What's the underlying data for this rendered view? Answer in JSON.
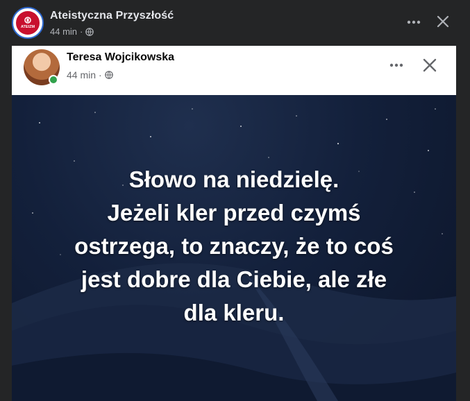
{
  "outer_post": {
    "page_name": "Ateistyczna Przyszłość",
    "avatar_text": "ATEIZM",
    "time": "44 min",
    "separator": "·",
    "more_icon": "more-horizontal-icon",
    "close_icon": "close-icon"
  },
  "shared_post": {
    "author_name": "Teresa Wojcikowska",
    "time": "44 min",
    "separator": "·",
    "online": true,
    "more_icon": "more-horizontal-icon",
    "close_icon": "close-icon"
  },
  "image_text": {
    "lines": [
      "Słowo na niedzielę.",
      "Jeżeli kler przed czymś",
      "ostrzega, to znaczy, że to coś",
      "jest dobre dla Ciebie, ale złe",
      "dla kleru."
    ]
  },
  "colors": {
    "dark_background": "#242526",
    "card_background": "#ffffff",
    "online_green": "#31a24c",
    "night_sky": "#13203b"
  }
}
